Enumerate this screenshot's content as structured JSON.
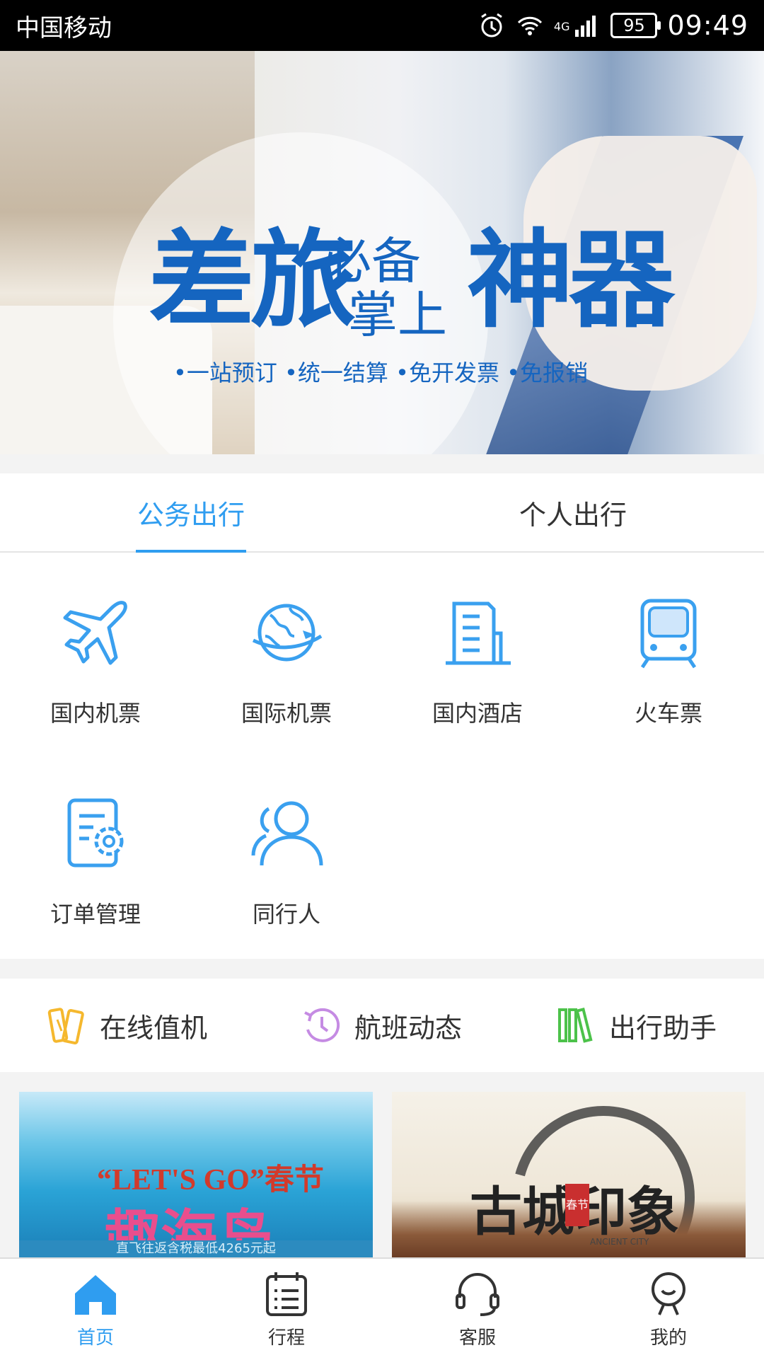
{
  "status": {
    "carrier": "中国移动",
    "network": "4G",
    "battery": "95",
    "time": "09:49"
  },
  "banner": {
    "title_big1": "差旅",
    "title_small1": "必备",
    "title_small2": "掌上",
    "title_big2": "神器",
    "subtitle": "•一站预订  •统一结算  •免开发票  •免报销",
    "slide_count": 3,
    "active_slide": 2
  },
  "tabs": [
    {
      "label": "公务出行",
      "active": true
    },
    {
      "label": "个人出行",
      "active": false
    }
  ],
  "services": [
    {
      "label": "国内机票",
      "icon": "airplane-icon"
    },
    {
      "label": "国际机票",
      "icon": "globe-plane-icon"
    },
    {
      "label": "国内酒店",
      "icon": "building-icon"
    },
    {
      "label": "火车票",
      "icon": "train-icon"
    },
    {
      "label": "订单管理",
      "icon": "order-settings-icon"
    },
    {
      "label": "同行人",
      "icon": "companion-icon"
    }
  ],
  "quick_links": [
    {
      "label": "在线值机",
      "icon": "boarding-pass-icon",
      "color": "#f5b82e"
    },
    {
      "label": "航班动态",
      "icon": "clock-history-icon",
      "color": "#c58be3"
    },
    {
      "label": "出行助手",
      "icon": "books-icon",
      "color": "#4cc24a"
    }
  ],
  "promos": [
    {
      "line1": "“LET'S GO”春节",
      "line2": "趣海岛",
      "bottom": "直飞往返含税最低4265元起"
    },
    {
      "title": "古城印象",
      "stamp": "春节",
      "sub": "ANCIENT CITY"
    }
  ],
  "bottom_nav": [
    {
      "label": "首页",
      "icon": "home-icon",
      "active": true
    },
    {
      "label": "行程",
      "icon": "itinerary-icon",
      "active": false
    },
    {
      "label": "客服",
      "icon": "headset-icon",
      "active": false
    },
    {
      "label": "我的",
      "icon": "profile-icon",
      "active": false
    }
  ],
  "colors": {
    "accent": "#2f9df0",
    "banner_text": "#1565c0",
    "icon_blue": "#3aa0ef"
  }
}
